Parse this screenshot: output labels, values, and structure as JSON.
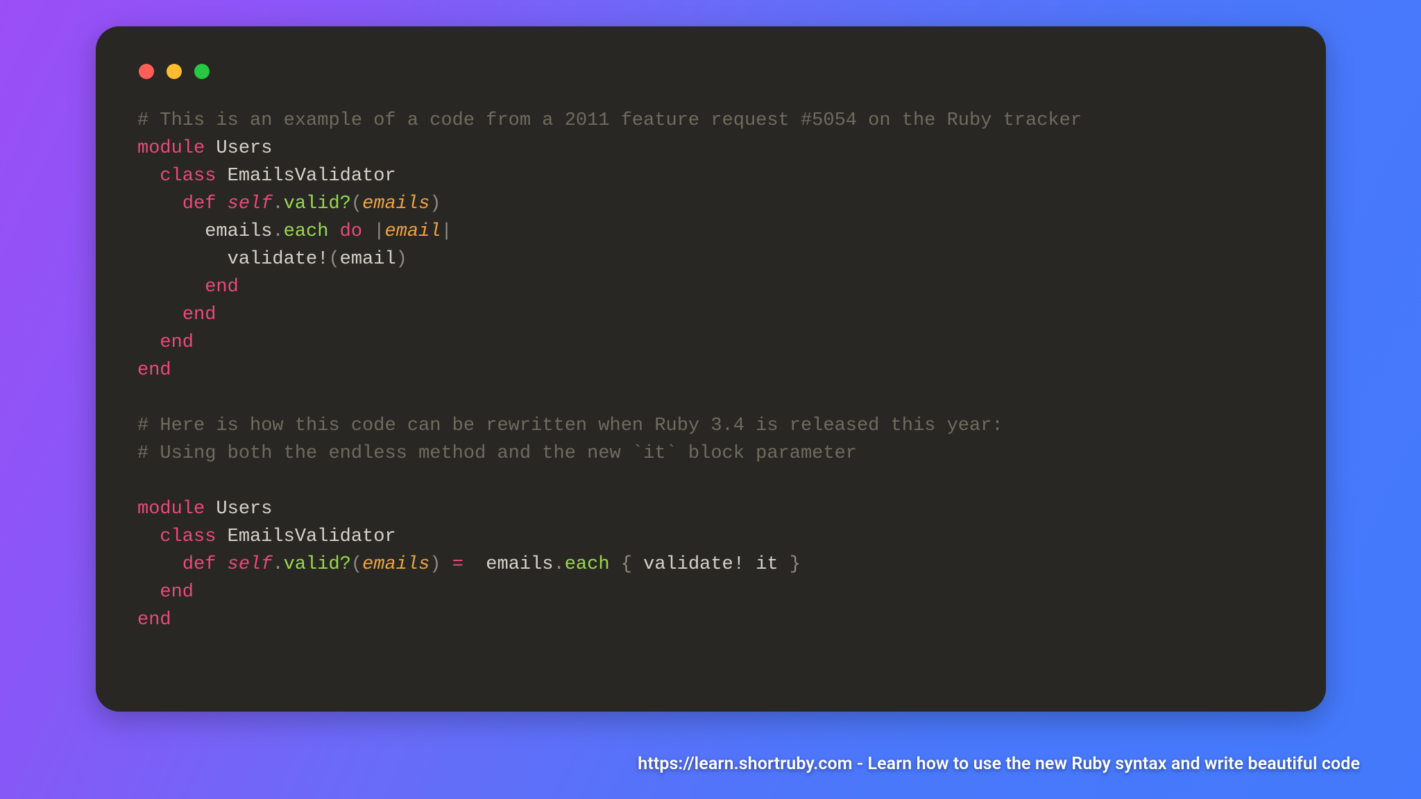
{
  "footer": {
    "text": "https://learn.shortruby.com - Learn how to use the new Ruby syntax and write beautiful code"
  },
  "code": {
    "comment_top": "# This is an example of a code from a 2011 feature request #5054 on the Ruby tracker",
    "module_kw": "module",
    "module_name": "Users",
    "class_kw": "class",
    "class_name": "EmailsValidator",
    "def_kw": "def",
    "self_kw": "self",
    "dot": ".",
    "method_valid": "valid?",
    "lparen": "(",
    "rparen": ")",
    "param_emails": "emails",
    "ident_emails": "emails",
    "method_each": "each",
    "do_kw": "do",
    "pipe": "|",
    "param_email": "email",
    "call_validate": "validate!",
    "arg_email": "email",
    "end_kw": "end",
    "comment_mid1": "# Here is how this code can be rewritten when Ruby 3.4 is released this year:",
    "comment_mid2": "# Using both the endless method and the new `it` block parameter",
    "eq": "=",
    "lbrace": "{",
    "rbrace": "}",
    "it_kw": "it"
  }
}
